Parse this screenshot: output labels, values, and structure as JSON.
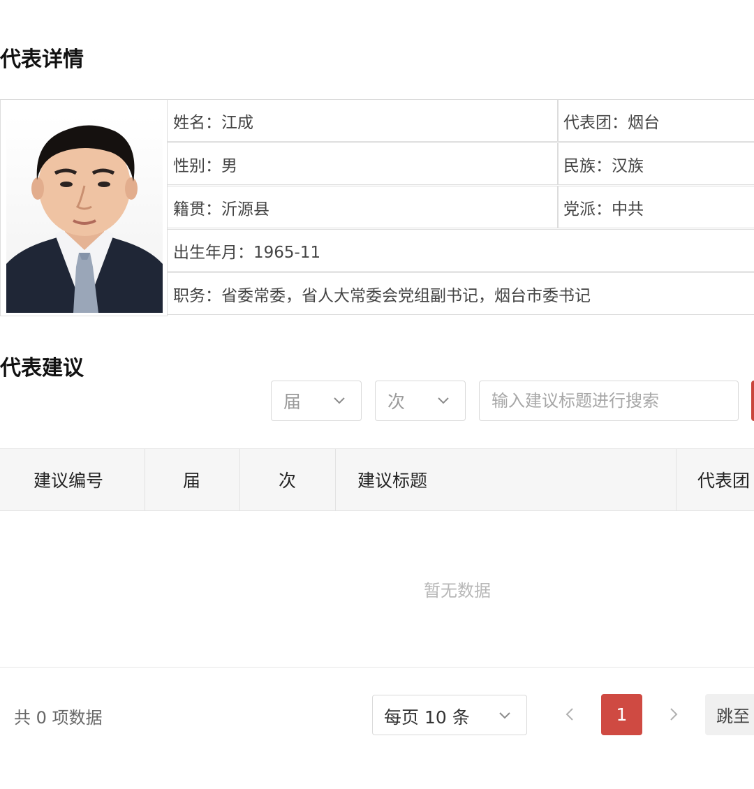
{
  "detail": {
    "title": "代表详情",
    "fields": {
      "name": "姓名：江成",
      "delegation": "代表团：烟台",
      "gender": "性别：男",
      "ethnicity": "民族：汉族",
      "native_place": "籍贯：沂源县",
      "party": "党派：中共",
      "birth": "出生年月：1965-11",
      "position": "职务：省委常委，省人大常委会党组副书记，烟台市委书记"
    }
  },
  "suggestions": {
    "title": "代表建议",
    "filters": {
      "session_label": "届",
      "meeting_label": "次",
      "search_placeholder": "输入建议标题进行搜索"
    },
    "columns": [
      "建议编号",
      "届",
      "次",
      "建议标题",
      "代表团"
    ],
    "empty_text": "暂无数据"
  },
  "pagination": {
    "total_text": "共 0 项数据",
    "page_size": "每页 10 条",
    "current_page": "1",
    "jump_label": "跳至"
  },
  "colors": {
    "accent": "#cf4a42",
    "border": "#dcdcdc",
    "header_bg": "#f6f6f6"
  },
  "icons": [
    "chevron-down-icon",
    "chevron-left-icon",
    "chevron-right-icon"
  ]
}
